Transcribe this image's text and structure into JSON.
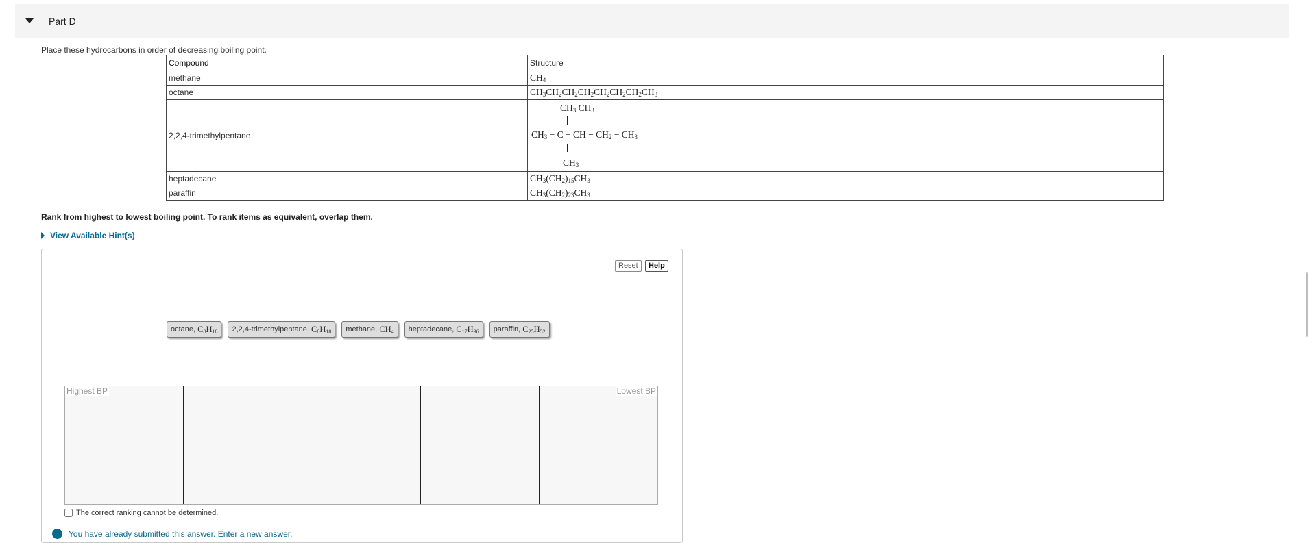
{
  "part": {
    "title": "Part D"
  },
  "question": {
    "prompt": "Place these hydrocarbons in order of decreasing boiling point."
  },
  "table": {
    "headers": [
      "Compound",
      "Structure"
    ],
    "rows": [
      {
        "compound": "methane",
        "structure": "CH4"
      },
      {
        "compound": "octane",
        "structure": "CH3CH2CH2CH2CH2CH2CH2CH3"
      },
      {
        "compound": "2,2,4-trimethylpentane",
        "structure": "CH3-C(CH3)2-CH-CH2-CH3 with CH3 on CH"
      },
      {
        "compound": "heptadecane",
        "structure": "CH3(CH2)15CH3"
      },
      {
        "compound": "paraffin",
        "structure": "CH3(CH2)23CH3"
      }
    ]
  },
  "ranking": {
    "instruction": "Rank from highest to lowest boiling point. To rank items as equivalent, overlap them.",
    "hint_label": "View Available Hint(s)",
    "reset_label": "Reset",
    "help_label": "Help",
    "items": [
      {
        "name": "octane,",
        "formula": "C8H18"
      },
      {
        "name": "2,2,4-trimethylpentane,",
        "formula": "C8H18"
      },
      {
        "name": "methane,",
        "formula": "CH4"
      },
      {
        "name": "heptadecane,",
        "formula": "C17H36"
      },
      {
        "name": "paraffin,",
        "formula": "C25H52"
      }
    ],
    "high_label": "Highest BP",
    "low_label": "Lowest BP",
    "cannot_label": "The correct ranking cannot be determined.",
    "notice": "You have already submitted this answer. Enter a new answer."
  },
  "colors": {
    "link": "#0a6a8e",
    "header_bg": "#f4f4f4"
  },
  "icons": [
    "caret-down-icon",
    "caret-right-icon",
    "info-icon"
  ]
}
